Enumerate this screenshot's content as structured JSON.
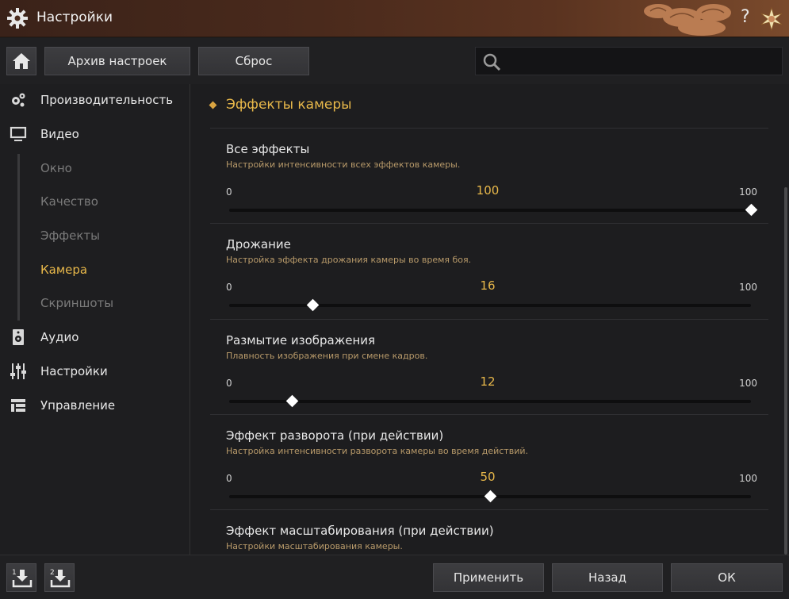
{
  "window": {
    "title": "Настройки",
    "help_label": "?"
  },
  "toolbar": {
    "archive_label": "Архив настроек",
    "reset_label": "Сброс",
    "search_placeholder": ""
  },
  "sidebar": {
    "items": [
      {
        "label": "Производительность",
        "icon": "gears-icon"
      },
      {
        "label": "Видео",
        "icon": "monitor-icon"
      },
      {
        "label": "Окно",
        "sub": true
      },
      {
        "label": "Качество",
        "sub": true
      },
      {
        "label": "Эффекты",
        "sub": true
      },
      {
        "label": "Камера",
        "sub": true,
        "active": true
      },
      {
        "label": "Скриншоты",
        "sub": true
      },
      {
        "label": "Аудио",
        "icon": "speaker-icon"
      },
      {
        "label": "Настройки",
        "icon": "sliders-icon"
      },
      {
        "label": "Управление",
        "icon": "layout-icon"
      }
    ]
  },
  "main": {
    "section_title": "Эффекты камеры",
    "settings": [
      {
        "name": "Все эффекты",
        "desc": "Настройки интенсивности всех эффектов камеры.",
        "min": "0",
        "max": "100",
        "value": "100",
        "fraction": 1.0
      },
      {
        "name": "Дрожание",
        "desc": "Настройка эффекта дрожания камеры во время боя.",
        "min": "0",
        "max": "100",
        "value": "16",
        "fraction": 0.16
      },
      {
        "name": "Размытие изображения",
        "desc": "Плавность изображения при смене кадров.",
        "min": "0",
        "max": "100",
        "value": "12",
        "fraction": 0.12
      },
      {
        "name": "Эффект разворота (при действии)",
        "desc": "Настройка интенсивности разворота камеры во время действий.",
        "min": "0",
        "max": "100",
        "value": "50",
        "fraction": 0.5
      },
      {
        "name": "Эффект масштабирования (при действии)",
        "desc": "Настройки масштабирования камеры.",
        "min": "",
        "max": "",
        "value": "",
        "fraction": null
      }
    ]
  },
  "footer": {
    "download1_badge": "1",
    "download2_badge": "2",
    "apply_label": "Применить",
    "back_label": "Назад",
    "ok_label": "ОК"
  },
  "colors": {
    "accent": "#e8b84a",
    "desc": "#b89a6a",
    "bg": "#1d1d1f"
  }
}
